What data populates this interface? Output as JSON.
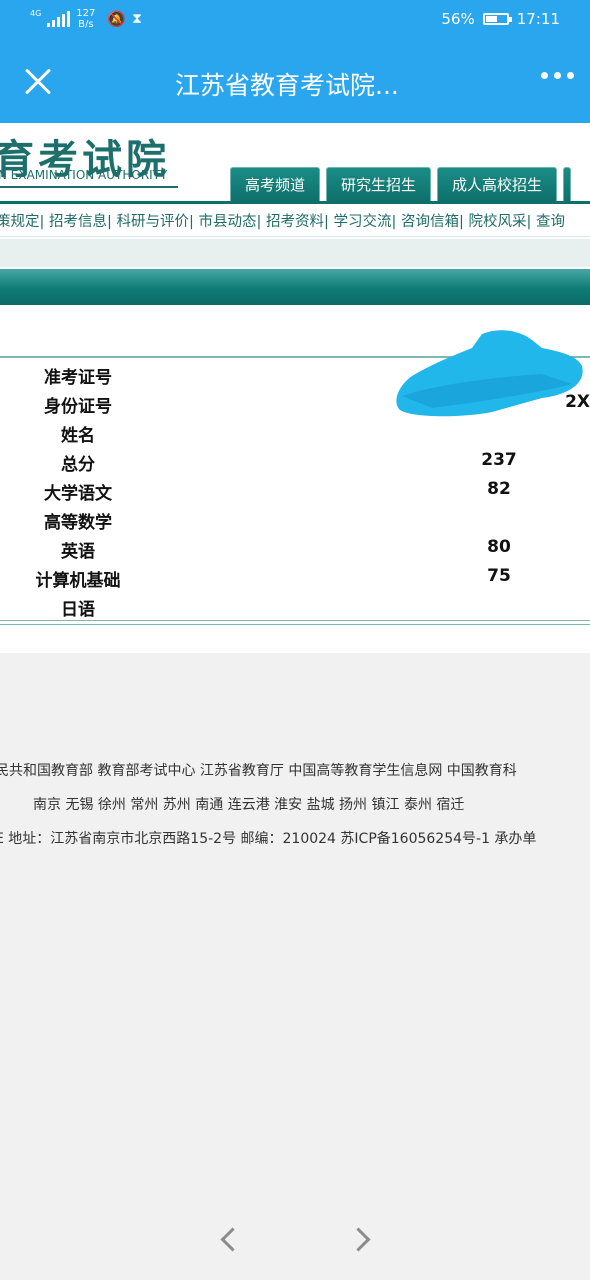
{
  "status": {
    "net": "4G",
    "speed_value": "127",
    "speed_unit": "B/s",
    "battery": "56%",
    "battery_level": 0.56,
    "time": "17:11"
  },
  "appbar": {
    "title": "江苏省教育考试院..."
  },
  "site": {
    "logo_cn": "育考试院",
    "logo_en": "N EXAMINATION AUTHORITY",
    "tabs": [
      "高考频道",
      "研究生招生",
      "成人高校招生"
    ],
    "nav": "策规定| 招考信息| 科研与评价| 市县动态| 招考资料| 学习交流| 咨询信箱| 院校风采| 查询"
  },
  "result": {
    "rows": [
      {
        "label": "准考证号",
        "value": ""
      },
      {
        "label": "身份证号",
        "value": "2X"
      },
      {
        "label": "姓名",
        "value": ""
      },
      {
        "label": "总分",
        "value": "237"
      },
      {
        "label": "大学语文",
        "value": "82"
      },
      {
        "label": "高等数学",
        "value": ""
      },
      {
        "label": "英语",
        "value": "80"
      },
      {
        "label": "计算机基础",
        "value": "75"
      },
      {
        "label": "日语",
        "value": ""
      }
    ]
  },
  "footer": {
    "links": "民共和国教育部  教育部考试中心  江苏省教育厅  中国高等教育学生信息网  中国教育科",
    "cities": "南京  无锡  徐州  常州  苏州  南通  连云港  淮安  盐城  扬州  镇江  泰州  宿迁",
    "address": "E  地址：江苏省南京市北京西路15-2号  邮编：210024  苏ICP备16056254号-1  承办单"
  },
  "colors": {
    "appbar": "#2aa6ee",
    "brand_teal": "#0f6f6a",
    "nav_text": "#1f6c68",
    "redaction": "#22b7ea"
  }
}
